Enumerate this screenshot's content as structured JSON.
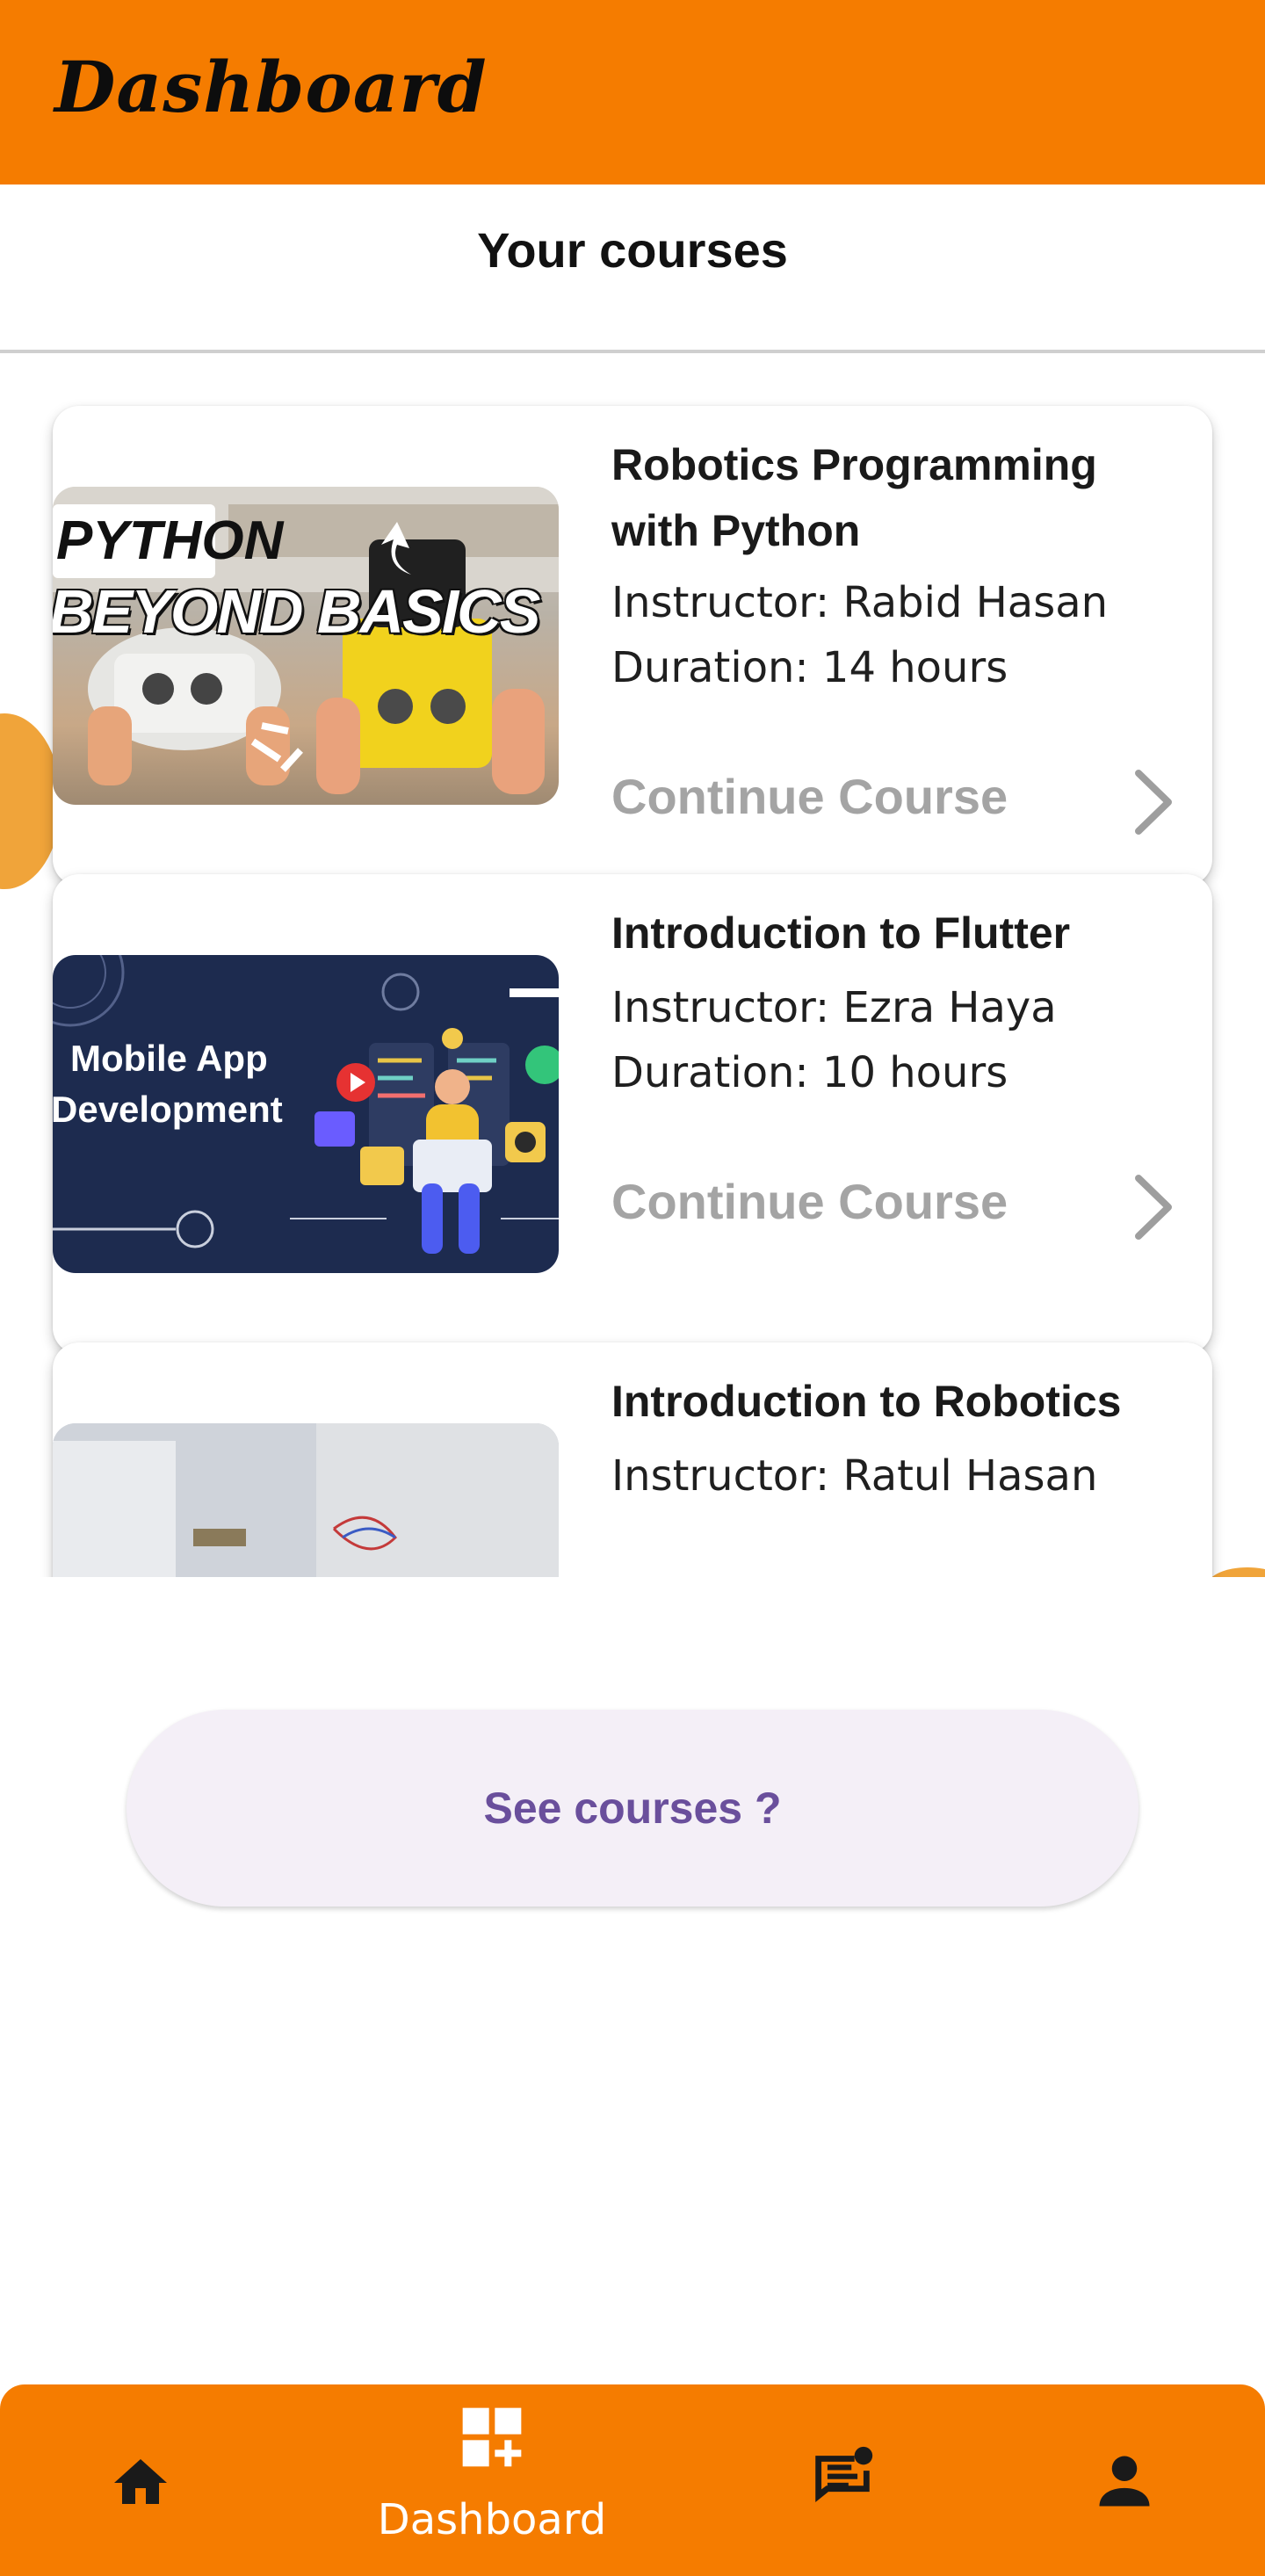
{
  "app_bar": {
    "title": "Dashboard"
  },
  "section": {
    "title": "Your courses"
  },
  "courses": [
    {
      "title": "Robotics Programming with Python",
      "instructor": "Instructor: Rabid Hasan",
      "duration": "Duration: 14 hours",
      "action": "Continue Course",
      "thumbnail_text": [
        "PYTHON",
        "BEYOND BASICS"
      ]
    },
    {
      "title": "Introduction to Flutter",
      "instructor": "Instructor: Ezra Haya",
      "duration": "Duration: 10 hours",
      "action": "Continue Course",
      "thumbnail_text": [
        "Mobile App",
        "Development"
      ]
    },
    {
      "title": "Introduction to Robotics",
      "instructor": "Instructor: Ratul Hasan"
    }
  ],
  "see_courses_button": {
    "label": "See courses ?"
  },
  "bottom_nav": {
    "items": [
      {
        "icon": "home-icon"
      },
      {
        "icon": "dashboard-add-icon",
        "label": "Dashboard",
        "active": true
      },
      {
        "icon": "chat-notification-icon"
      },
      {
        "icon": "person-icon"
      }
    ]
  },
  "colors": {
    "brand_orange": "#f57c00",
    "button_text": "#6a4f9c",
    "button_bg": "#f4eff7",
    "muted_action": "#a4a4a4"
  }
}
